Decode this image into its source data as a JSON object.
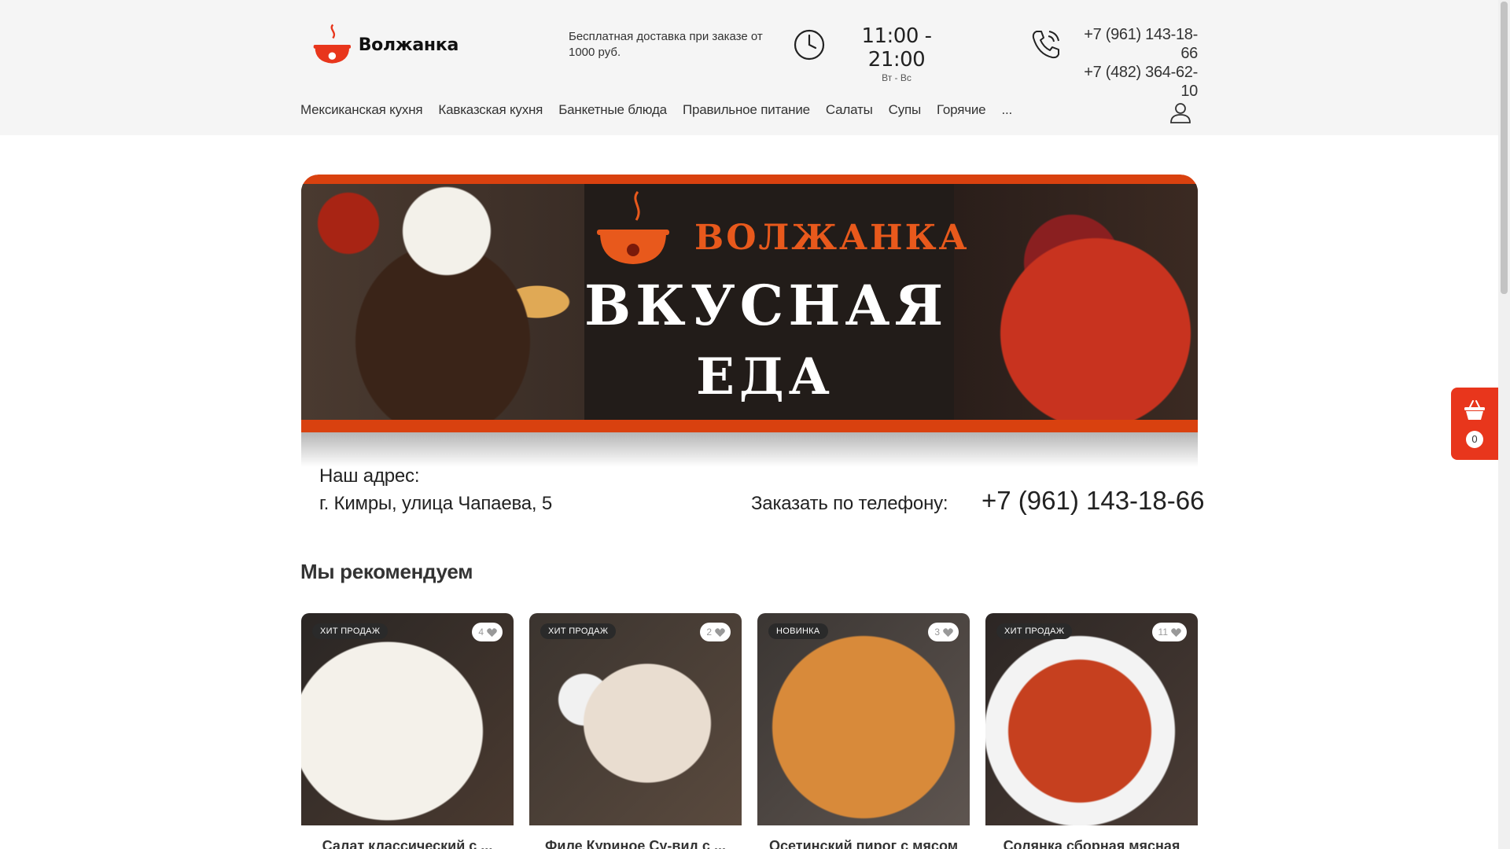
{
  "header": {
    "brand": "Волжанка",
    "delivery_text": "Бесплатная доставка при заказе от 1000 руб.",
    "hours": "11:00 - 21:00",
    "days": "Вт - Вс",
    "phones": [
      "+7 (961) 143-18-66",
      "+7 (482) 364-62-10"
    ]
  },
  "nav": {
    "items": [
      "Мексиканская кухня",
      "Кавказская кухня",
      "Банкетные блюда",
      "Правильное питание",
      "Салаты",
      "Супы",
      "Горячие",
      "..."
    ]
  },
  "banner": {
    "brand": "ВОЛЖАНКА",
    "title_line1": "ВКУСНАЯ",
    "title_line2": "ЕДА",
    "address_label": "Наш адрес:",
    "address_value": "г. Кимры, улица Чапаева, 5",
    "order_label": "Заказать по телефону:",
    "order_phone": "+7 (961) 143-18-66"
  },
  "cart": {
    "count": "0"
  },
  "recommend": {
    "title": "Мы рекомендуем",
    "cards": [
      {
        "badge": "ХИТ ПРОДАЖ",
        "likes": "4",
        "name": "Салат классический с ..."
      },
      {
        "badge": "ХИТ ПРОДАЖ",
        "likes": "2",
        "name": "Филе Куриное Су-вид с ..."
      },
      {
        "badge": "НОВИНКА",
        "likes": "3",
        "name": "Осетинский пирог с мясом"
      },
      {
        "badge": "ХИТ ПРОДАЖ",
        "likes": "11",
        "name": "Солянка сборная мясная"
      }
    ]
  },
  "colors": {
    "accent": "#e8361c",
    "brand_orange": "#d9410f",
    "header_bg": "#f5f5f5"
  }
}
